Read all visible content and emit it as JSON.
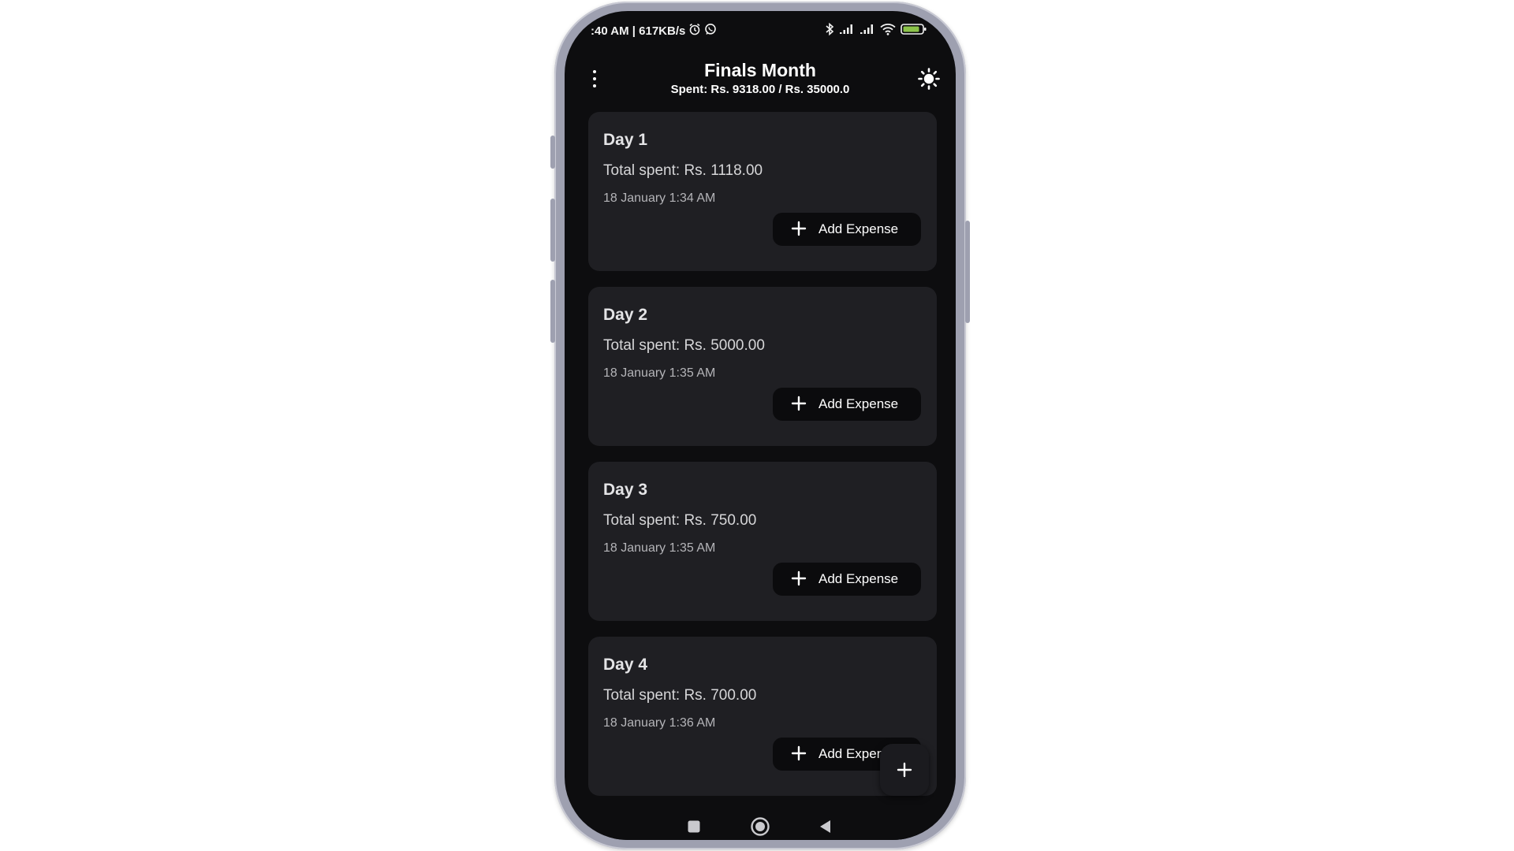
{
  "status_bar": {
    "time_speed": ":40 AM | 617KB/s",
    "icons": [
      "alarm-icon",
      "whatsapp-icon",
      "bluetooth-icon",
      "signal-icon",
      "signal-icon",
      "wifi-icon",
      "battery-icon"
    ]
  },
  "header": {
    "title": "Finals Month",
    "summary": "Spent: Rs. 9318.00 / Rs. 35000.0"
  },
  "days": [
    {
      "title": "Day 1",
      "total": "Total spent: Rs. 1118.00",
      "date": "18 January 1:34 AM",
      "button": "Add Expense"
    },
    {
      "title": "Day 2",
      "total": "Total spent: Rs. 5000.00",
      "date": "18 January 1:35 AM",
      "button": "Add Expense"
    },
    {
      "title": "Day 3",
      "total": "Total spent: Rs. 750.00",
      "date": "18 January 1:35 AM",
      "button": "Add Expense"
    },
    {
      "title": "Day 4",
      "total": "Total spent: Rs. 700.00",
      "date": "18 January 1:36 AM",
      "button": "Add Expen"
    }
  ],
  "colors": {
    "background": "#0d0d0f",
    "card": "#1f1f23",
    "button": "#0b0b0d",
    "battery": "#8bc34a"
  }
}
